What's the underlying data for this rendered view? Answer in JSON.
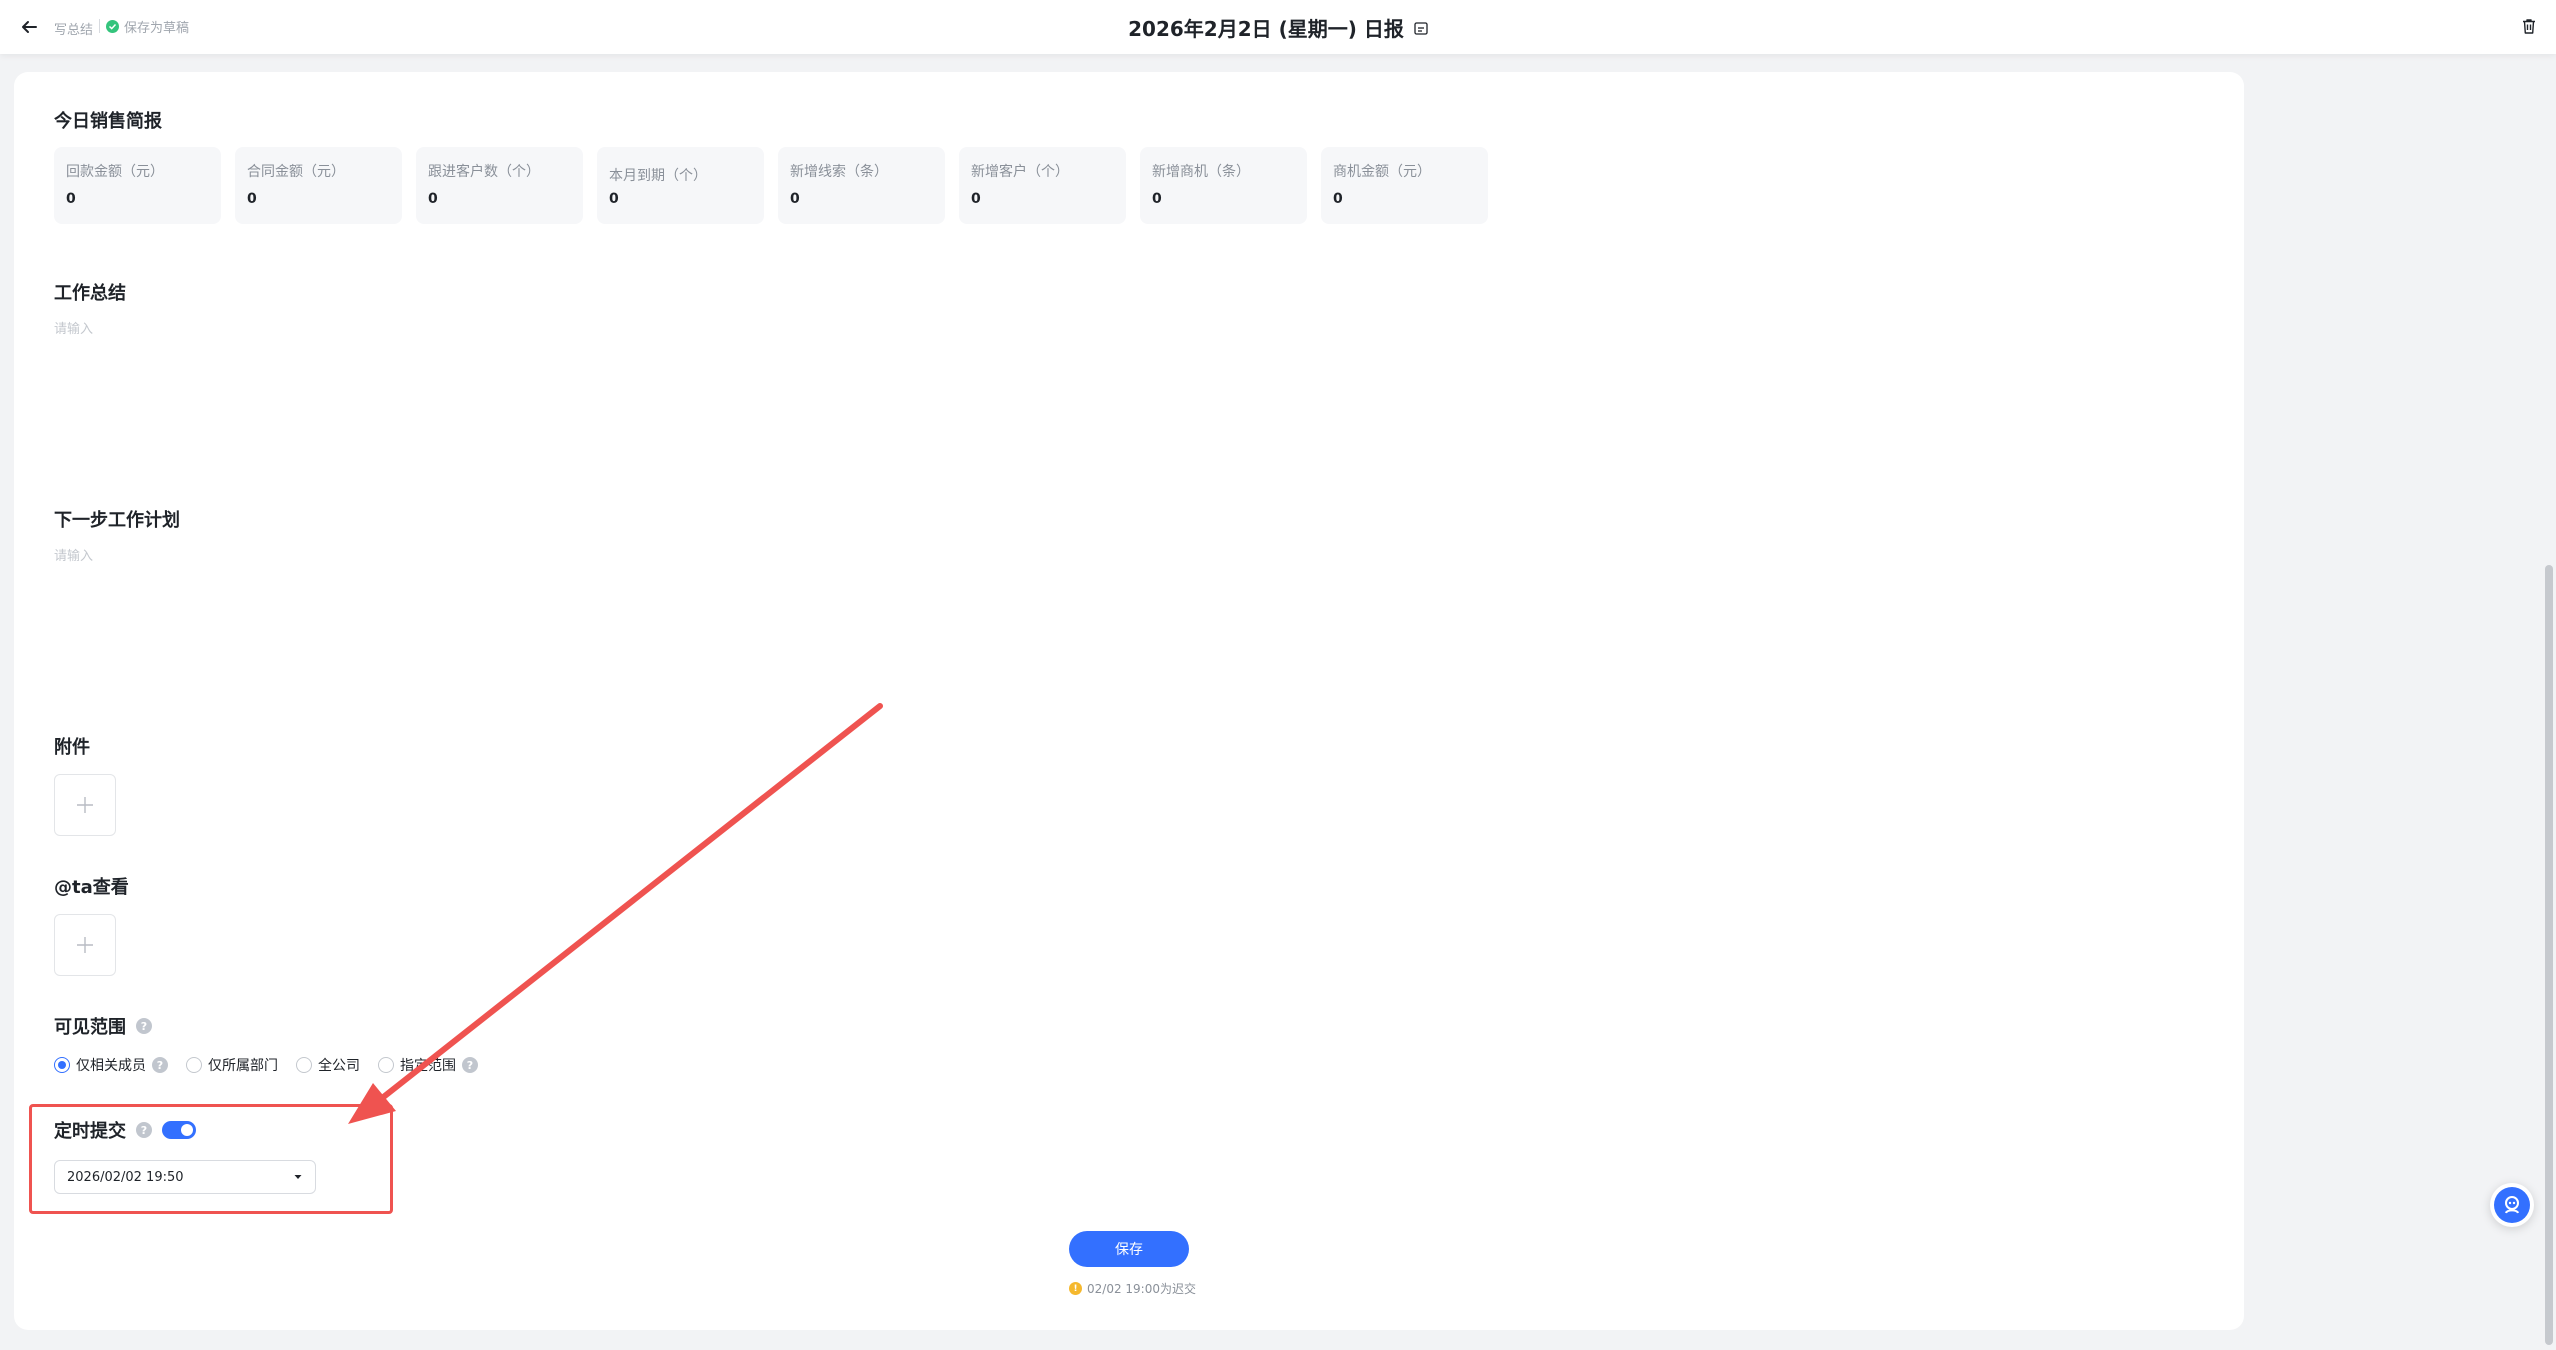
{
  "header": {
    "crumb": "写总结",
    "draft_status": "保存为草稿",
    "title": "2026年2月2日 (星期一) 日报"
  },
  "sales_brief": {
    "title": "今日销售简报",
    "stats": [
      {
        "label": "回款金额（元）",
        "value": "0"
      },
      {
        "label": "合同金额（元）",
        "value": "0"
      },
      {
        "label": "跟进客户数（个）",
        "value": "0"
      },
      {
        "label": "本月到期（个）",
        "value": "0"
      },
      {
        "label": "新增线索（条）",
        "value": "0"
      },
      {
        "label": "新增客户（个）",
        "value": "0"
      },
      {
        "label": "新增商机（条）",
        "value": "0"
      },
      {
        "label": "商机金额（元）",
        "value": "0"
      }
    ]
  },
  "work_summary": {
    "title": "工作总结",
    "placeholder": "请输入"
  },
  "next_plan": {
    "title": "下一步工作计划",
    "placeholder": "请输入"
  },
  "attachment": {
    "title": "附件"
  },
  "mention": {
    "title": "@ta查看"
  },
  "visibility": {
    "title": "可见范围",
    "options": [
      "仅相关成员",
      "仅所属部门",
      "全公司",
      "指定范围"
    ],
    "selected": "仅相关成员"
  },
  "scheduled_submit": {
    "title": "定时提交",
    "enabled": true,
    "datetime": "2026/02/02 19:50"
  },
  "footer": {
    "save_label": "保存",
    "late_note": "02/02 19:00为迟交"
  },
  "colors": {
    "accent": "#3370ff",
    "annotation": "#ef5350",
    "success": "#34c47c",
    "warning": "#f5b82e"
  },
  "icons": {
    "back": "arrow-left-icon",
    "draft": "check-circle-icon",
    "title": "calendar-icon",
    "trash": "trash-icon",
    "help": "question-circle-icon",
    "upload": "plus-icon",
    "dropdown": "caret-down-icon",
    "assistant": "assistant-robot-icon"
  }
}
